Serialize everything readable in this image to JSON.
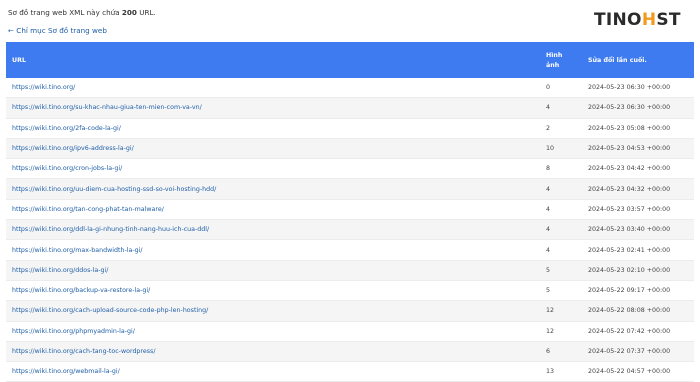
{
  "intro": {
    "prefix": "Sơ đồ trang web XML này chứa",
    "count": "200",
    "suffix": "URL."
  },
  "back_link": "← Chỉ mục Sơ đồ trang web",
  "logo": {
    "text_main": "TINO",
    "text_accent": "H",
    "text_tail": "ST"
  },
  "table": {
    "headers": {
      "url": "URL",
      "images_line1": "Hình",
      "images_line2": "ảnh",
      "modified": "Sửa đổi lần cuối."
    },
    "rows": [
      {
        "url": "https://wiki.tino.org/",
        "images": "0",
        "modified": "2024-05-23 06:30 +00:00"
      },
      {
        "url": "https://wiki.tino.org/su-khac-nhau-giua-ten-mien-com-va-vn/",
        "images": "4",
        "modified": "2024-05-23 06:30 +00:00"
      },
      {
        "url": "https://wiki.tino.org/2fa-code-la-gi/",
        "images": "2",
        "modified": "2024-05-23 05:08 +00:00"
      },
      {
        "url": "https://wiki.tino.org/ipv6-address-la-gi/",
        "images": "10",
        "modified": "2024-05-23 04:53 +00:00"
      },
      {
        "url": "https://wiki.tino.org/cron-jobs-la-gi/",
        "images": "8",
        "modified": "2024-05-23 04:42 +00:00"
      },
      {
        "url": "https://wiki.tino.org/uu-diem-cua-hosting-ssd-so-voi-hosting-hdd/",
        "images": "4",
        "modified": "2024-05-23 04:32 +00:00"
      },
      {
        "url": "https://wiki.tino.org/tan-cong-phat-tan-malware/",
        "images": "4",
        "modified": "2024-05-23 03:57 +00:00"
      },
      {
        "url": "https://wiki.tino.org/ddl-la-gi-nhung-tinh-nang-huu-ich-cua-ddl/",
        "images": "4",
        "modified": "2024-05-23 03:40 +00:00"
      },
      {
        "url": "https://wiki.tino.org/max-bandwidth-la-gi/",
        "images": "4",
        "modified": "2024-05-23 02:41 +00:00"
      },
      {
        "url": "https://wiki.tino.org/ddos-la-gi/",
        "images": "5",
        "modified": "2024-05-23 02:10 +00:00"
      },
      {
        "url": "https://wiki.tino.org/backup-va-restore-la-gi/",
        "images": "5",
        "modified": "2024-05-22 09:17 +00:00"
      },
      {
        "url": "https://wiki.tino.org/cach-upload-source-code-php-len-hosting/",
        "images": "12",
        "modified": "2024-05-22 08:08 +00:00"
      },
      {
        "url": "https://wiki.tino.org/phpmyadmin-la-gi/",
        "images": "12",
        "modified": "2024-05-22 07:42 +00:00"
      },
      {
        "url": "https://wiki.tino.org/cach-tang-toc-wordpress/",
        "images": "6",
        "modified": "2024-05-22 07:37 +00:00"
      },
      {
        "url": "https://wiki.tino.org/webmail-la-gi/",
        "images": "13",
        "modified": "2024-05-22 04:57 +00:00"
      }
    ]
  },
  "colors": {
    "header_bg": "#3f7bf0",
    "link": "#1f5fa8",
    "logo_accent": "#f39a1e"
  }
}
